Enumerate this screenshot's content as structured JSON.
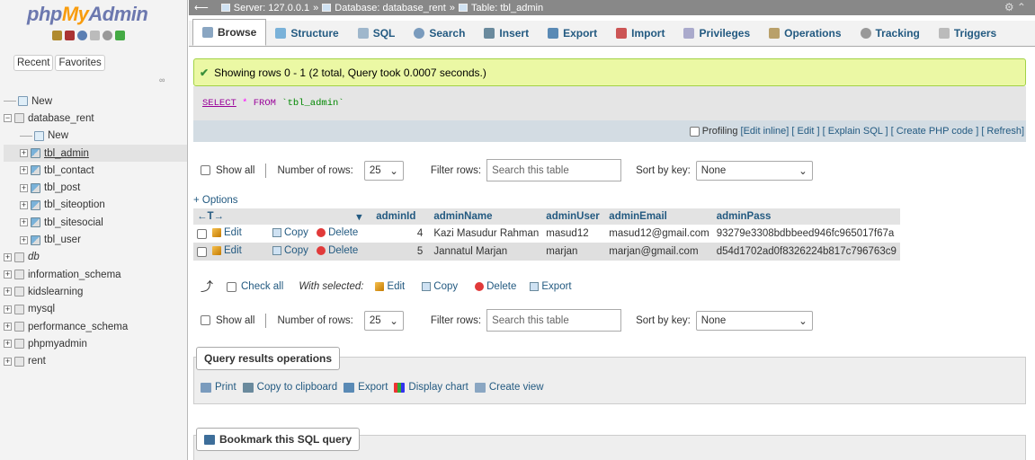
{
  "sidebar": {
    "logo_php": "php",
    "logo_my": "My",
    "logo_admin": "Admin",
    "recent": "Recent",
    "favorites": "Favorites",
    "tree": [
      {
        "label": "New",
        "type": "new",
        "level": 0
      },
      {
        "label": "database_rent",
        "type": "db",
        "level": 0
      },
      {
        "label": "New",
        "type": "new",
        "level": 1
      },
      {
        "label": "tbl_admin",
        "type": "table",
        "level": 1
      },
      {
        "label": "tbl_contact",
        "type": "table",
        "level": 1
      },
      {
        "label": "tbl_post",
        "type": "table",
        "level": 1
      },
      {
        "label": "tbl_siteoption",
        "type": "table",
        "level": 1
      },
      {
        "label": "tbl_sitesocial",
        "type": "table",
        "level": 1
      },
      {
        "label": "tbl_user",
        "type": "table",
        "level": 1
      },
      {
        "label": "db",
        "type": "db",
        "level": 0
      },
      {
        "label": "information_schema",
        "type": "db",
        "level": 0
      },
      {
        "label": "kidslearning",
        "type": "db",
        "level": 0
      },
      {
        "label": "mysql",
        "type": "db",
        "level": 0
      },
      {
        "label": "performance_schema",
        "type": "db",
        "level": 0
      },
      {
        "label": "phpmyadmin",
        "type": "db",
        "level": 0
      },
      {
        "label": "rent",
        "type": "db",
        "level": 0
      }
    ]
  },
  "breadcrumb": {
    "server": "Server: 127.0.0.1",
    "sep": "»",
    "database": "Database: database_rent",
    "table": "Table: tbl_admin"
  },
  "tabs": [
    "Browse",
    "Structure",
    "SQL",
    "Search",
    "Insert",
    "Export",
    "Import",
    "Privileges",
    "Operations",
    "Tracking",
    "Triggers"
  ],
  "success_message": "Showing rows 0 - 1 (2 total, Query took 0.0007 seconds.)",
  "sql": {
    "select": "SELECT",
    "star": "*",
    "from": "FROM",
    "table": "`tbl_admin`"
  },
  "profiling": {
    "label": "Profiling",
    "links": "[Edit inline] [ Edit ] [ Explain SQL ] [ Create PHP code ] [ Refresh]"
  },
  "nav": {
    "show_all": "Show all",
    "number_of_rows": "Number of rows:",
    "rows_value": "25",
    "filter_rows": "Filter rows:",
    "filter_placeholder": "Search this table",
    "sort_by_key": "Sort by key:",
    "sort_value": "None"
  },
  "options_link": "+ Options",
  "table": {
    "columns": [
      "adminId",
      "adminName",
      "adminUser",
      "adminEmail",
      "adminPass"
    ],
    "rows": [
      {
        "id": "4",
        "name": "Kazi Masudur Rahman",
        "user": "masud12",
        "email": "masud12@gmail.com",
        "pass": "93279e3308bdbbeed946fc965017f67a"
      },
      {
        "id": "5",
        "name": "Jannatul Marjan",
        "user": "marjan",
        "email": "marjan@gmail.com",
        "pass": "d54d1702ad0f8326224b817c796763c9"
      }
    ],
    "edit": "Edit",
    "copy": "Copy",
    "delete": "Delete"
  },
  "bulk": {
    "check_all": "Check all",
    "with_selected": "With selected:",
    "edit": "Edit",
    "copy": "Copy",
    "delete": "Delete",
    "export": "Export"
  },
  "query_results": {
    "title": "Query results operations",
    "print": "Print",
    "copy_clipboard": "Copy to clipboard",
    "export": "Export",
    "display_chart": "Display chart",
    "create_view": "Create view"
  },
  "bookmark": {
    "title": "Bookmark this SQL query"
  },
  "colors": {
    "link": "#235a81",
    "success_bg": "#ebf8a4",
    "accent": "#6c78af"
  }
}
